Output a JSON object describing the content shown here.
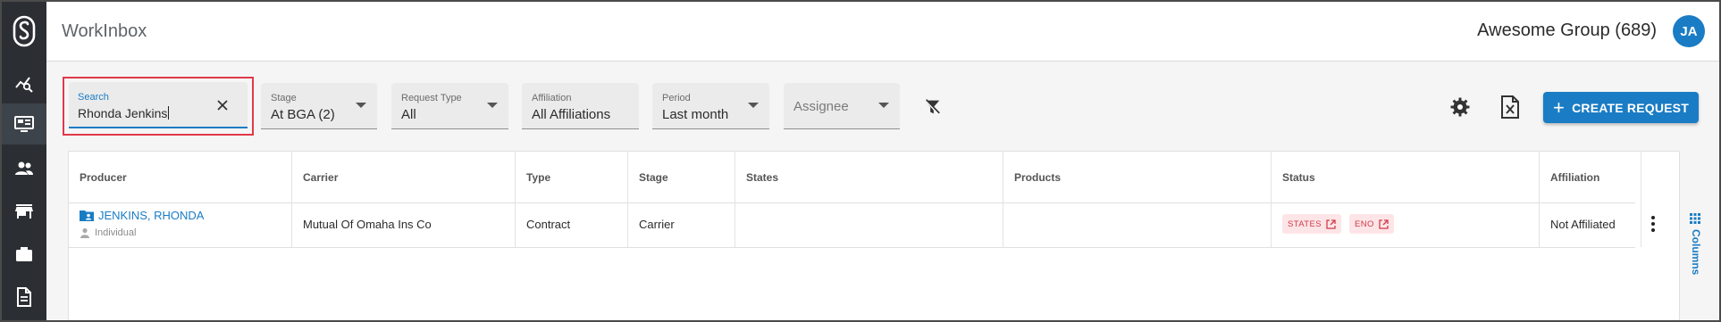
{
  "header": {
    "app_title": "WorkInbox",
    "group_name": "Awesome Group (689)",
    "avatar_initials": "JA"
  },
  "sidebar": {
    "items": [
      {
        "icon": "analytics-icon"
      },
      {
        "icon": "inbox-dashboard-icon",
        "active": true
      },
      {
        "icon": "people-icon"
      },
      {
        "icon": "store-icon"
      },
      {
        "icon": "briefcase-icon"
      },
      {
        "icon": "document-icon"
      }
    ]
  },
  "filters": {
    "search": {
      "label": "Search",
      "value": "Rhonda Jenkins"
    },
    "stage": {
      "label": "Stage",
      "value": "At BGA (2)"
    },
    "request_type": {
      "label": "Request Type",
      "value": "All"
    },
    "affiliation": {
      "label": "Affiliation",
      "value": "All Affiliations"
    },
    "period": {
      "label": "Period",
      "value": "Last month"
    },
    "assignee": {
      "placeholder": "Assignee"
    }
  },
  "toolbar": {
    "create_label": "CREATE REQUEST"
  },
  "table": {
    "columns": [
      "Producer",
      "Carrier",
      "Type",
      "Stage",
      "States",
      "Products",
      "Status",
      "Affiliation"
    ],
    "rows": [
      {
        "producer": "JENKINS, RHONDA",
        "producer_type": "Individual",
        "carrier": "Mutual Of Omaha Ins Co",
        "type": "Contract",
        "stage": "Carrier",
        "states": "",
        "products": "",
        "status_chips": [
          "STATES",
          "ENO"
        ],
        "affiliation": "Not Affiliated"
      }
    ]
  },
  "columns_panel": {
    "label": "Columns"
  },
  "colors": {
    "accent": "#1a7cc4",
    "sidebar": "#2b2f34",
    "chip_bg": "#fde5e7",
    "chip_text": "#d03a4a",
    "highlight": "#e0394a"
  }
}
